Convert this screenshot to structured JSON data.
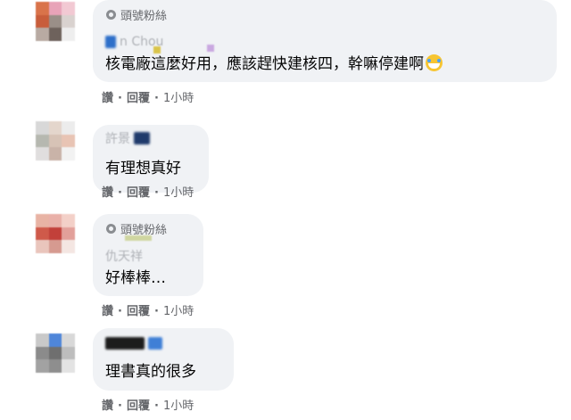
{
  "comments": [
    {
      "badge": "頭號粉絲",
      "name": "n Chou",
      "text": "核電廠這麼好用，應該趕快建核四，幹嘛停建啊",
      "emoji": "laughing-tears-emoji",
      "actions": {
        "like": "讚",
        "reply": "回覆",
        "time": "1小時"
      }
    },
    {
      "name": "許景",
      "text": "有理想真好",
      "actions": {
        "like": "讚",
        "reply": "回覆",
        "time": "1小時"
      }
    },
    {
      "badge": "頭號粉絲",
      "name": "仇天祥",
      "text": "好棒棒…",
      "actions": {
        "like": "讚",
        "reply": "回覆",
        "time": "1小時"
      }
    },
    {
      "text": "理書真的很多",
      "actions": {
        "like": "讚",
        "reply": "回覆",
        "time": "1小時"
      }
    }
  ],
  "separator": "·",
  "colors": {
    "bubble": "#f0f2f5",
    "text": "#050505",
    "meta": "#65676b"
  }
}
